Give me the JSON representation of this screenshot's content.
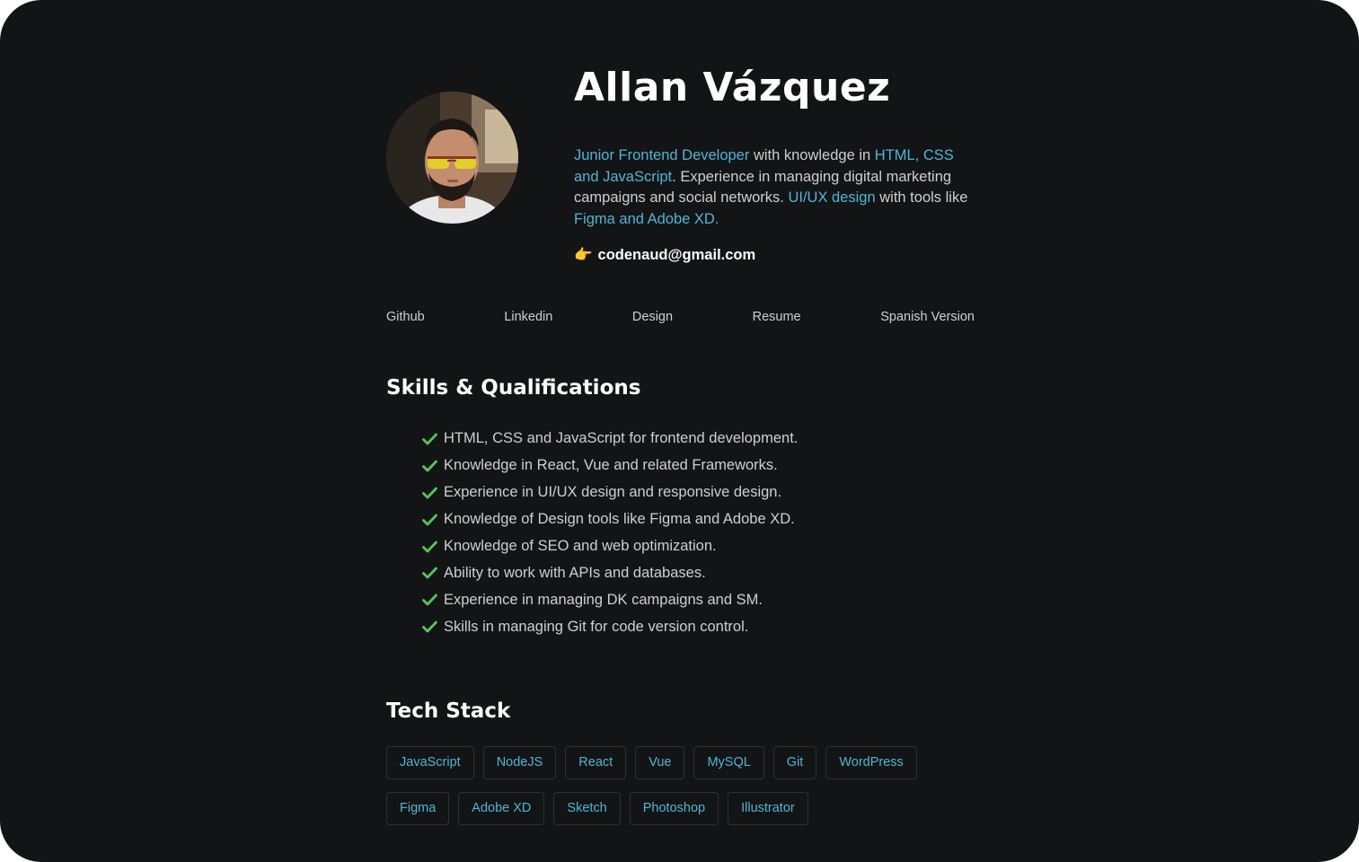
{
  "profile": {
    "name": "Allan Vázquez",
    "bio": {
      "role": "Junior Frontend Developer",
      "t1": " with knowledge in ",
      "langs": "HTML, CSS and JavaScript",
      "t2": ". Experience in managing digital marketing campaigns and social networks. ",
      "ux": "UI/UX design",
      "t3": " with tools like ",
      "tools": "Figma and Adobe XD."
    },
    "email_icon": "👉",
    "email": "codenaud@gmail.com"
  },
  "nav": {
    "links": [
      "Github",
      "Linkedin",
      "Design",
      "Resume",
      "Spanish Version"
    ]
  },
  "skills": {
    "title": "Skills & Qualifications",
    "items": [
      "HTML, CSS and JavaScript for frontend development.",
      "Knowledge in React, Vue and related Frameworks.",
      "Experience in UI/UX design and responsive design.",
      "Knowledge of Design tools like Figma and Adobe XD.",
      "Knowledge of SEO and web optimization.",
      "Ability to work with APIs and databases.",
      "Experience in managing DK campaigns and SM.",
      "Skills in managing Git for code version control."
    ]
  },
  "stack": {
    "title": "Tech Stack",
    "row1": [
      "JavaScript",
      "NodeJS",
      "React",
      "Vue",
      "MySQL",
      "Git",
      "WordPress"
    ],
    "row2": [
      "Figma",
      "Adobe XD",
      "Sketch",
      "Photoshop",
      "Illustrator"
    ]
  },
  "colors": {
    "background": "#131416",
    "accent": "#4fb6d4",
    "check": "#5cc45a",
    "text": "#cfcfcf",
    "heading": "#ffffff"
  },
  "icons": {
    "check": "check-icon",
    "pointer": "pointing-hand-icon"
  }
}
